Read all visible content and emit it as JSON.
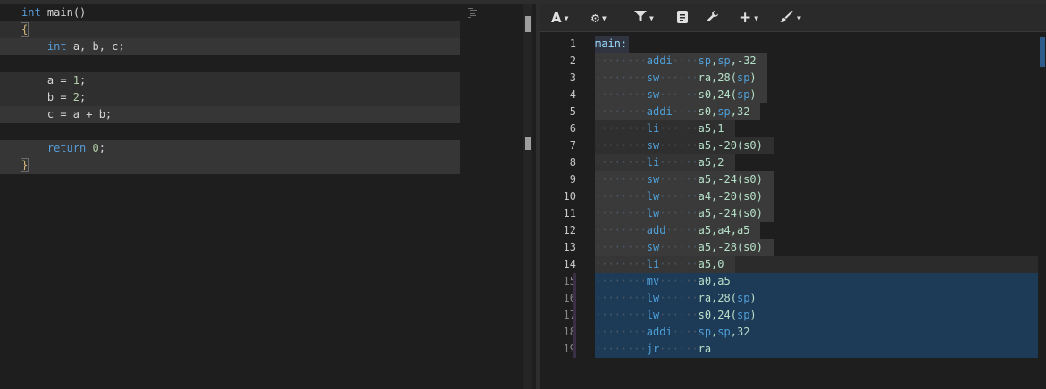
{
  "source": {
    "lines": [
      {
        "tokens": [
          {
            "t": "int",
            "c": "kw"
          },
          {
            "t": " main",
            "c": "plain"
          },
          {
            "t": "()",
            "c": "brace-plain"
          }
        ]
      },
      {
        "tokens": [
          {
            "t": "{",
            "c": "brace"
          }
        ]
      },
      {
        "tokens": [
          {
            "t": "    ",
            "c": "plain"
          },
          {
            "t": "int",
            "c": "kw"
          },
          {
            "t": " a, b, c;",
            "c": "plain"
          }
        ]
      },
      {
        "tokens": []
      },
      {
        "tokens": [
          {
            "t": "    a = ",
            "c": "plain"
          },
          {
            "t": "1",
            "c": "num"
          },
          {
            "t": ";",
            "c": "plain"
          }
        ]
      },
      {
        "tokens": [
          {
            "t": "    b = ",
            "c": "plain"
          },
          {
            "t": "2",
            "c": "num"
          },
          {
            "t": ";",
            "c": "plain"
          }
        ]
      },
      {
        "tokens": [
          {
            "t": "    c = a + b;",
            "c": "plain"
          }
        ]
      },
      {
        "tokens": []
      },
      {
        "tokens": [
          {
            "t": "    ",
            "c": "plain"
          },
          {
            "t": "return",
            "c": "kw"
          },
          {
            "t": " ",
            "c": "plain"
          },
          {
            "t": "0",
            "c": "num"
          },
          {
            "t": ";",
            "c": "plain"
          }
        ]
      },
      {
        "tokens": [
          {
            "t": "}",
            "c": "brace"
          }
        ]
      }
    ]
  },
  "toolbar": {
    "buttons": [
      {
        "name": "font-button",
        "icon": "A",
        "caret": true
      },
      {
        "name": "settings-button",
        "icon": "⚙",
        "caret": true
      },
      {
        "name": "filter-button",
        "icon": "filter",
        "caret": true
      },
      {
        "name": "document-button",
        "icon": "doc",
        "caret": false
      },
      {
        "name": "wrench-button",
        "icon": "wrench",
        "caret": false
      },
      {
        "name": "add-button",
        "icon": "+",
        "caret": true
      },
      {
        "name": "brush-button",
        "icon": "brush",
        "caret": true
      }
    ]
  },
  "assembly": {
    "lines": [
      {
        "n": "1",
        "label": "main:"
      },
      {
        "n": "2",
        "mn": "addi",
        "ops": [
          [
            "sp",
            "reg"
          ],
          [
            ",",
            "opnd"
          ],
          [
            "sp",
            "reg"
          ],
          [
            ",-32",
            "opnd"
          ]
        ]
      },
      {
        "n": "3",
        "mn": "sw",
        "ops": [
          [
            "ra,28(",
            "opnd"
          ],
          [
            "sp",
            "reg"
          ],
          [
            ")",
            "opnd"
          ]
        ]
      },
      {
        "n": "4",
        "mn": "sw",
        "ops": [
          [
            "s0,24(",
            "opnd"
          ],
          [
            "sp",
            "reg"
          ],
          [
            ")",
            "opnd"
          ]
        ]
      },
      {
        "n": "5",
        "mn": "addi",
        "ops": [
          [
            "s0,",
            "opnd"
          ],
          [
            "sp",
            "reg"
          ],
          [
            ",32",
            "opnd"
          ]
        ]
      },
      {
        "n": "6",
        "mn": "li",
        "ops": [
          [
            "a5,1",
            "opnd"
          ]
        ]
      },
      {
        "n": "7",
        "mn": "sw",
        "ops": [
          [
            "a5,-20(s0)",
            "opnd"
          ]
        ]
      },
      {
        "n": "8",
        "mn": "li",
        "ops": [
          [
            "a5,2",
            "opnd"
          ]
        ]
      },
      {
        "n": "9",
        "mn": "sw",
        "ops": [
          [
            "a5,-24(s0)",
            "opnd"
          ]
        ]
      },
      {
        "n": "10",
        "mn": "lw",
        "ops": [
          [
            "a4,-20(s0)",
            "opnd"
          ]
        ]
      },
      {
        "n": "11",
        "mn": "lw",
        "ops": [
          [
            "a5,-24(s0)",
            "opnd"
          ]
        ]
      },
      {
        "n": "12",
        "mn": "add",
        "ops": [
          [
            "a5,a4,a5",
            "opnd"
          ]
        ]
      },
      {
        "n": "13",
        "mn": "sw",
        "ops": [
          [
            "a5,-28(s0)",
            "opnd"
          ]
        ]
      },
      {
        "n": "14",
        "mn": "li",
        "ops": [
          [
            "a5,0",
            "opnd"
          ]
        ]
      },
      {
        "n": "15",
        "mn": "mv",
        "ops": [
          [
            "a0,a5",
            "opnd"
          ]
        ]
      },
      {
        "n": "16",
        "mn": "lw",
        "ops": [
          [
            "ra,28(",
            "opnd"
          ],
          [
            "sp",
            "reg"
          ],
          [
            ")",
            "opnd"
          ]
        ]
      },
      {
        "n": "17",
        "mn": "lw",
        "ops": [
          [
            "s0,24(",
            "opnd"
          ],
          [
            "sp",
            "reg"
          ],
          [
            ")",
            "opnd"
          ]
        ]
      },
      {
        "n": "18",
        "mn": "addi",
        "ops": [
          [
            "sp",
            "reg"
          ],
          [
            ",",
            "opnd"
          ],
          [
            "sp",
            "reg"
          ],
          [
            ",32",
            "opnd"
          ]
        ]
      },
      {
        "n": "19",
        "mn": "jr",
        "ops": [
          [
            "ra",
            "opnd"
          ]
        ]
      }
    ]
  },
  "colors": {
    "background": "#1e1e1e",
    "keyword": "#569cd6",
    "number": "#b5cea8",
    "brace": "#d7ba7d",
    "asm_highlight": "#1d3a57"
  }
}
